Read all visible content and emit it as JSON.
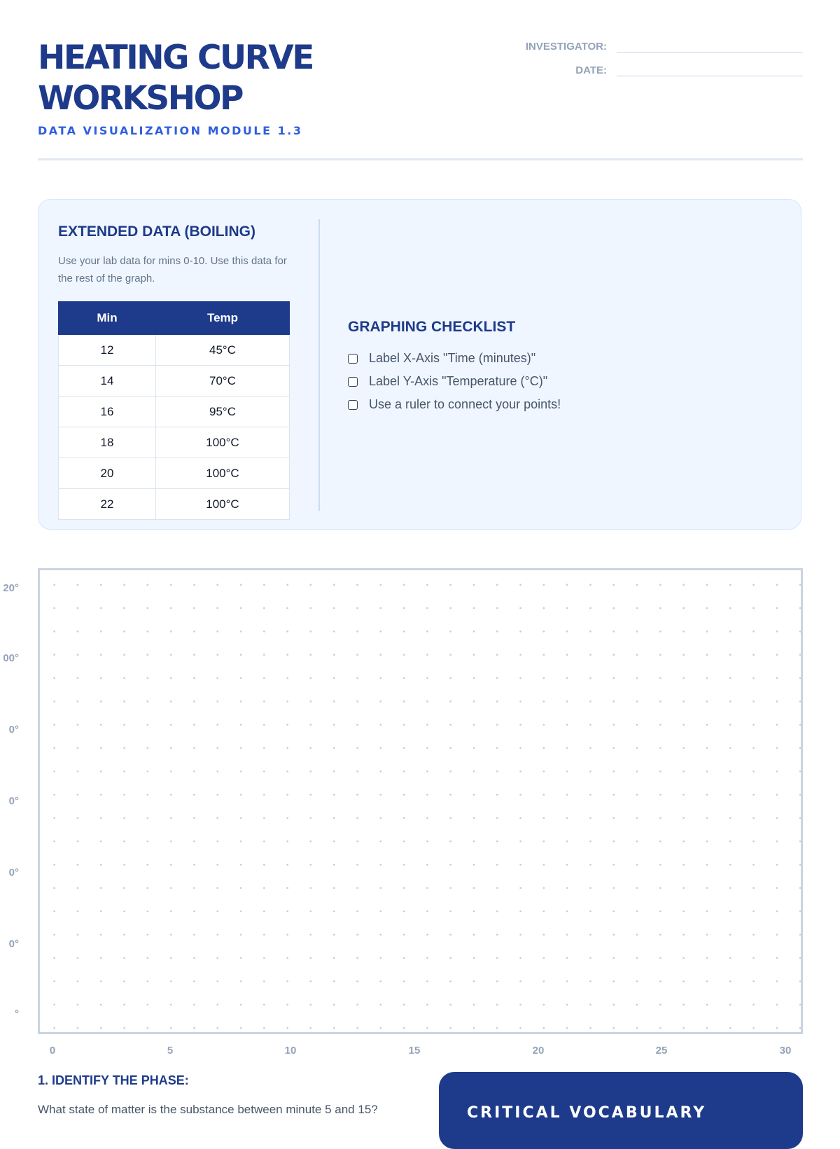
{
  "header": {
    "title": "HEATING CURVE WORKSHOP",
    "subtitle": "DATA VISUALIZATION MODULE 1.3",
    "investigator_label": "INVESTIGATOR:",
    "date_label": "DATE:"
  },
  "extended_data": {
    "heading": "EXTENDED DATA (BOILING)",
    "instructions": "Use your lab data for mins 0-10. Use this data for the rest of the graph.",
    "columns": [
      "Min",
      "Temp"
    ],
    "rows": [
      [
        "12",
        "45°C"
      ],
      [
        "14",
        "70°C"
      ],
      [
        "16",
        "95°C"
      ],
      [
        "18",
        "100°C"
      ],
      [
        "20",
        "100°C"
      ],
      [
        "22",
        "100°C"
      ]
    ]
  },
  "checklist": {
    "heading": "GRAPHING CHECKLIST",
    "items": [
      "Label X-Axis \"Time (minutes)\"",
      "Label Y-Axis \"Temperature (°C)\"",
      "Use a ruler to connect your points!"
    ]
  },
  "graph": {
    "y_ticks": [
      "20°",
      "00°",
      "0°",
      "0°",
      "0°",
      "0°",
      "°"
    ],
    "x_ticks": [
      "0",
      "5",
      "10",
      "15",
      "20",
      "25",
      "30"
    ]
  },
  "questions": {
    "q1_title": "1. IDENTIFY THE PHASE:",
    "q1_text": "What state of matter is the substance between minute 5 and 15?"
  },
  "vocabulary": {
    "title": "CRITICAL VOCABULARY"
  },
  "colors": {
    "primary": "#1e3a8a",
    "accent": "#2f5ee0",
    "panel_bg": "#eff6ff",
    "muted": "#94a3b8"
  }
}
